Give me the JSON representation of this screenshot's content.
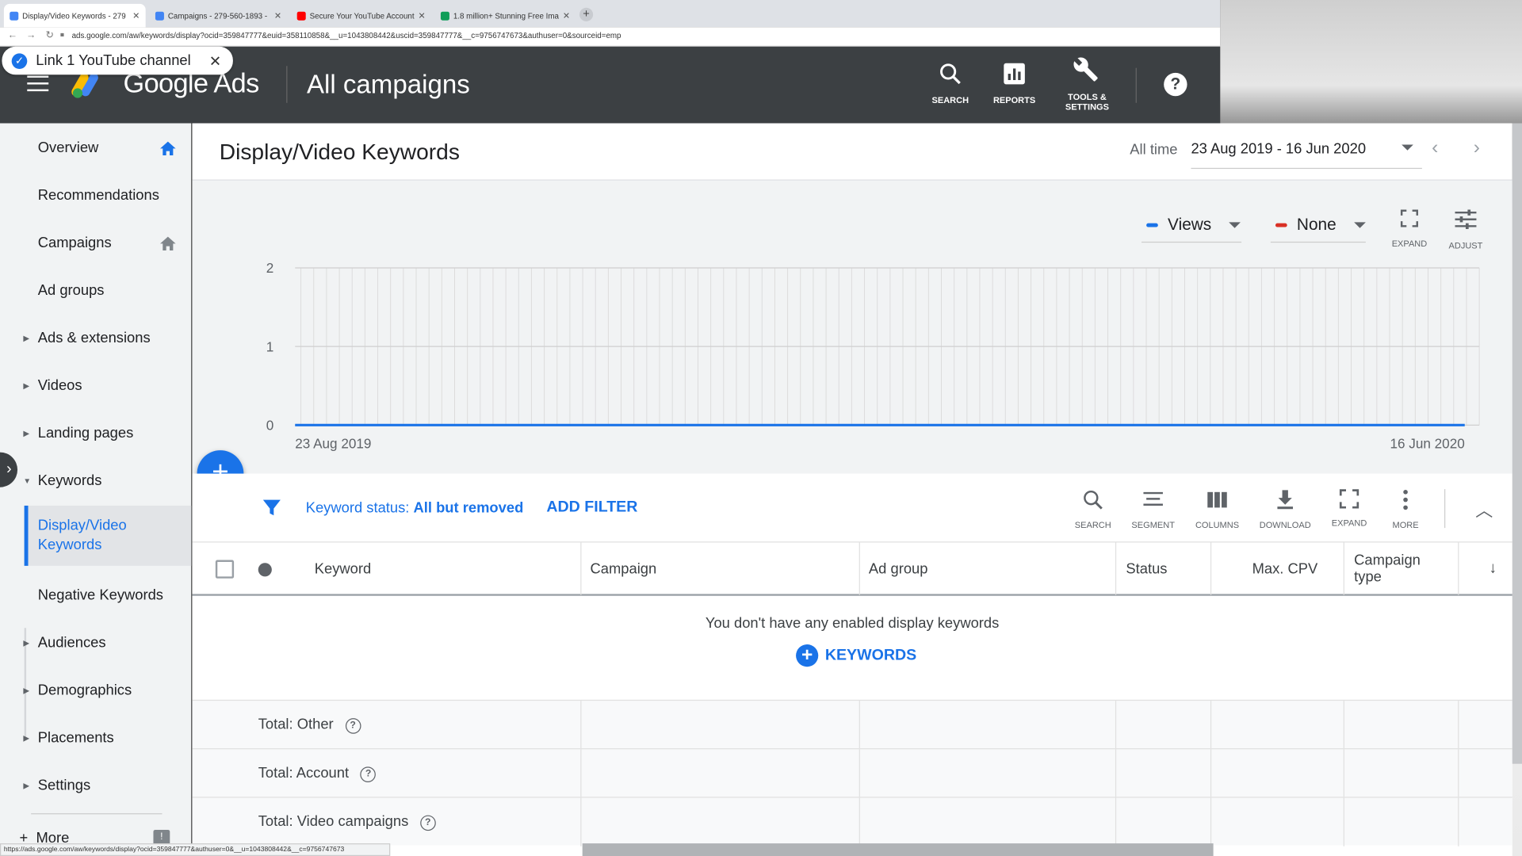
{
  "browser": {
    "tabs": [
      {
        "title": "Display/Video Keywords - 279",
        "favicon_color": "#4285f4",
        "active": true
      },
      {
        "title": "Campaigns - 279-560-1893 -",
        "favicon_color": "#4285f4",
        "active": false
      },
      {
        "title": "Secure Your YouTube Account",
        "favicon_color": "#ff0000",
        "active": false
      },
      {
        "title": "1.8 million+ Stunning Free Ima",
        "favicon_color": "#0f9d58",
        "active": false
      }
    ],
    "new_tab": "+",
    "url": "ads.google.com/aw/keywords/display?ocid=359847777&euid=358110858&__u=1043808442&uscid=359847777&__c=9756747673&authuser=0&sourceid=emp",
    "status_url": "https://ads.google.com/aw/keywords/display?ocid=359847777&authuser=0&__u=1043808442&__c=9756747673"
  },
  "toast": {
    "text": "Link 1 YouTube channel",
    "close": "✕",
    "check": "✓"
  },
  "header": {
    "brand": "Google Ads",
    "title": "All campaigns",
    "tools": {
      "search": "SEARCH",
      "reports": "REPORTS",
      "tools_line1": "TOOLS &",
      "tools_line2": "SETTINGS"
    },
    "help": "?"
  },
  "sidebar": {
    "items": [
      {
        "label": "Overview"
      },
      {
        "label": "Recommendations"
      },
      {
        "label": "Campaigns"
      },
      {
        "label": "Ad groups"
      },
      {
        "label": "Ads & extensions"
      },
      {
        "label": "Videos"
      },
      {
        "label": "Landing pages"
      },
      {
        "label": "Keywords"
      },
      {
        "label": "Display/Video Keywords"
      },
      {
        "label": "Negative Keywords"
      },
      {
        "label": "Audiences"
      },
      {
        "label": "Demographics"
      },
      {
        "label": "Placements"
      },
      {
        "label": "Settings"
      }
    ],
    "more": "More",
    "collapse": "›"
  },
  "page": {
    "title": "Display/Video Keywords",
    "range_label": "All time",
    "range_value": "23 Aug 2019 - 16 Jun 2020"
  },
  "chart": {
    "metric1": "Views",
    "metric2": "None",
    "colors": {
      "metric1": "#1a73e8",
      "metric2": "#d93025"
    },
    "expand": "EXPAND",
    "adjust": "ADJUST",
    "fab": "+"
  },
  "chart_data": {
    "type": "line",
    "x_start_label": "23 Aug 2019",
    "x_end_label": "16 Jun 2020",
    "yticks": [
      "0",
      "1",
      "2"
    ],
    "ylim": [
      0,
      2
    ],
    "series": [
      {
        "name": "Views",
        "values": [
          0,
          0
        ]
      }
    ],
    "grid": true
  },
  "filters": {
    "key": "Keyword status:",
    "value": "All but removed",
    "add": "ADD FILTER"
  },
  "table_tools": {
    "search": "SEARCH",
    "segment": "SEGMENT",
    "columns": "COLUMNS",
    "download": "DOWNLOAD",
    "expand": "EXPAND",
    "more": "MORE"
  },
  "table": {
    "columns": {
      "keyword": "Keyword",
      "campaign": "Campaign",
      "ad_group": "Ad group",
      "status": "Status",
      "max_cpv": "Max. CPV",
      "campaign_type_1": "Campaign",
      "campaign_type_2": "type"
    },
    "empty_message": "You don't have any enabled display keywords",
    "add_keywords": "KEYWORDS",
    "totals": [
      {
        "label": "Total: Other"
      },
      {
        "label": "Total: Account"
      },
      {
        "label": "Total: Video campaigns"
      }
    ]
  }
}
